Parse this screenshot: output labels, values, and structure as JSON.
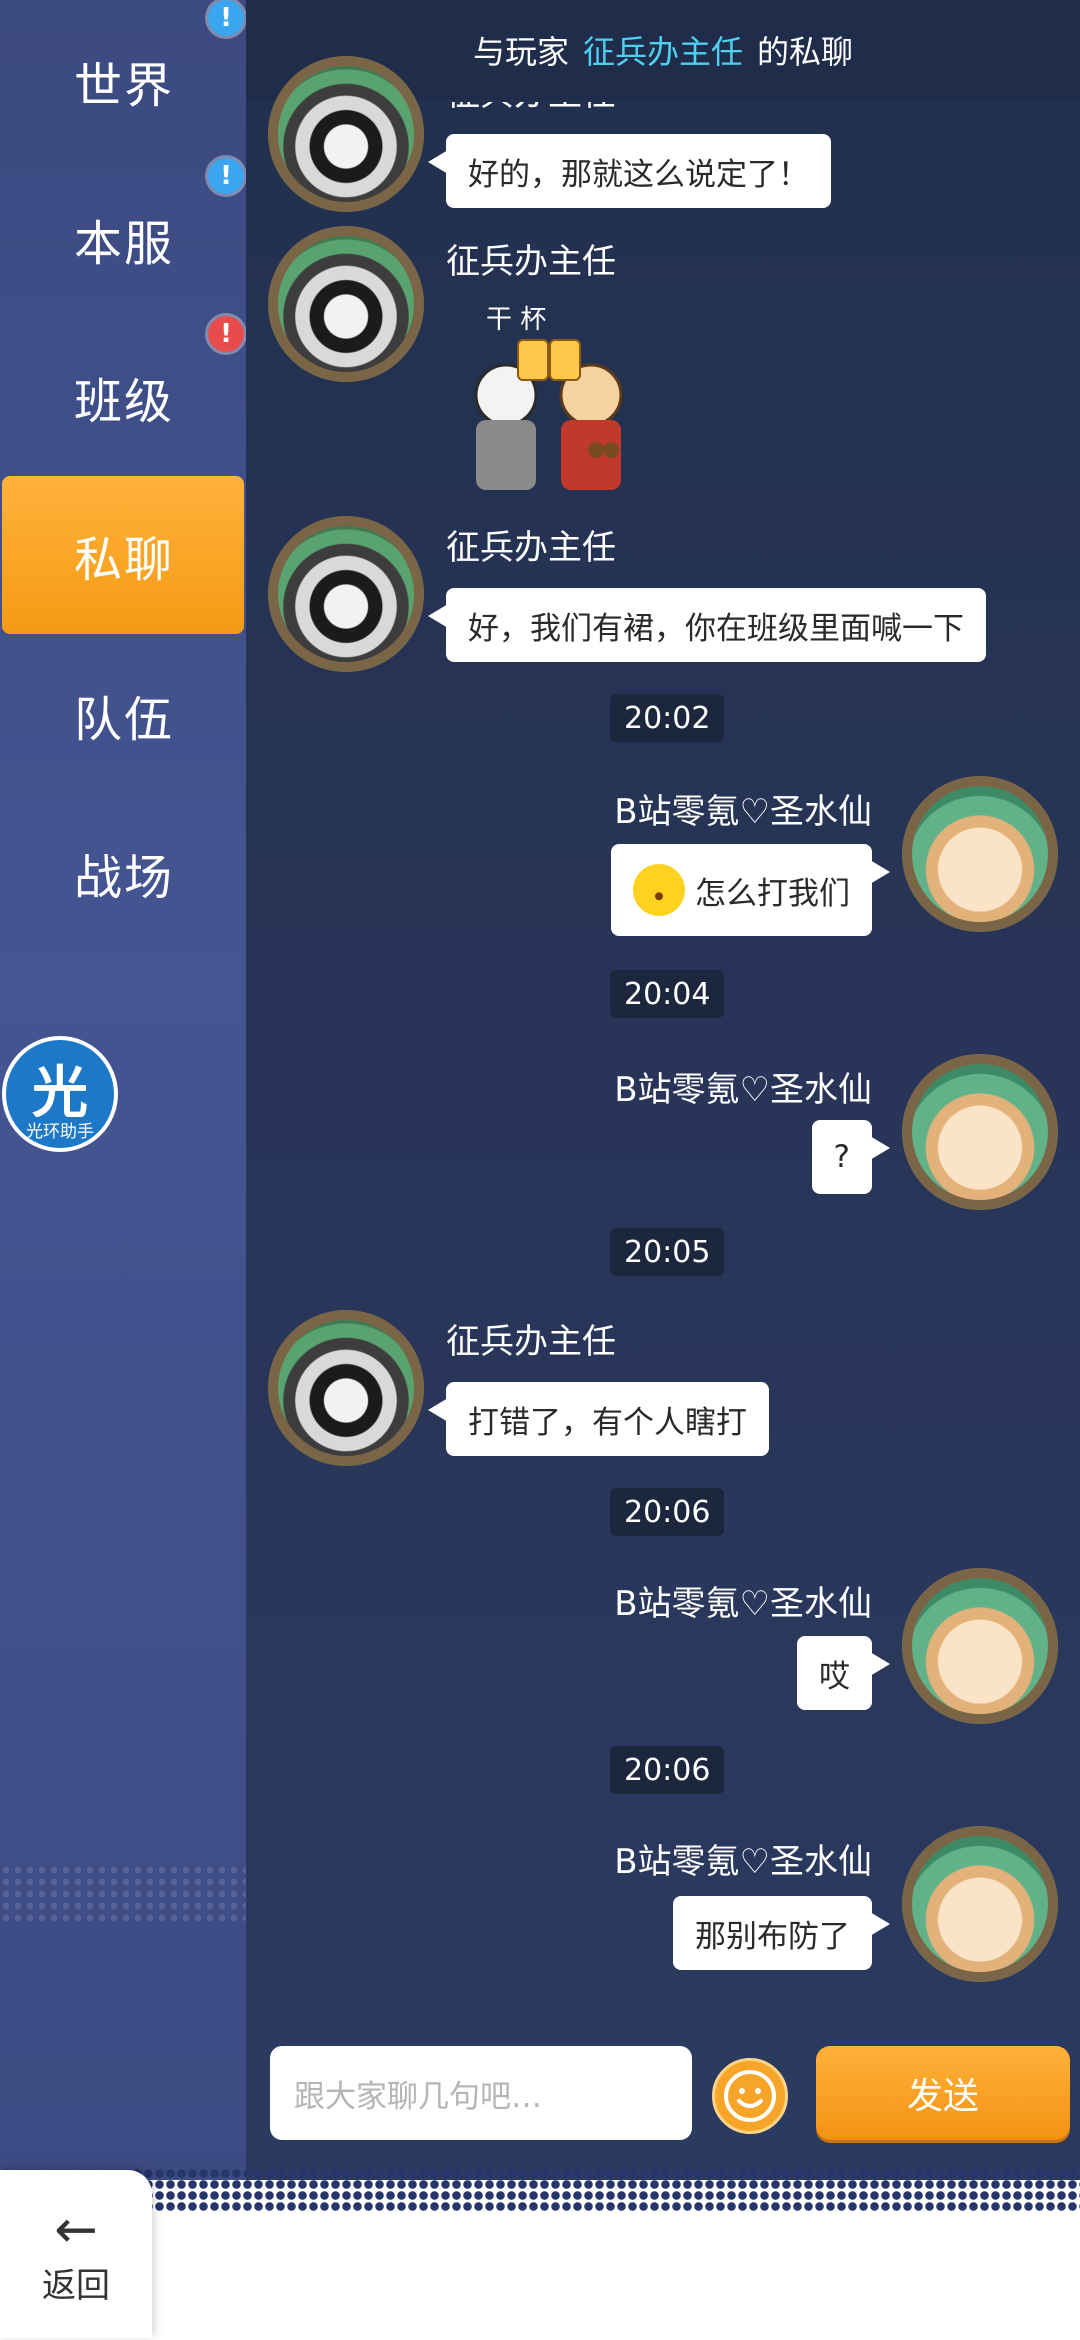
{
  "sidebar": {
    "items": [
      {
        "label": "世界",
        "badge": "!",
        "badge_color": "#3aa6f0"
      },
      {
        "label": "本服",
        "badge": "!",
        "badge_color": "#3aa6f0"
      },
      {
        "label": "班级",
        "badge": "!",
        "badge_color": "#e84b4b"
      },
      {
        "label": "私聊",
        "active": true
      },
      {
        "label": "队伍"
      },
      {
        "label": "战场"
      }
    ],
    "logo": {
      "big": "光",
      "small": "光环助手"
    },
    "active_color": "#f59a15"
  },
  "header": {
    "prefix": "与玩家",
    "player": "征兵办主任",
    "suffix": "的私聊",
    "highlight_color": "#4fd0f0"
  },
  "messages": [
    {
      "sender": "征兵办主任",
      "text": "好的，那就这么说定了！"
    },
    {
      "sender": "征兵办主任",
      "sticker": "干 杯"
    },
    {
      "sender": "征兵办主任",
      "text": "好，我们有裙，你在班级里面喊一下"
    },
    {
      "time": "20:02"
    },
    {
      "sender": "B站零氪♡圣水仙",
      "text": "怎么打我们",
      "emoji": "surprised-face"
    },
    {
      "time": "20:04"
    },
    {
      "sender": "B站零氪♡圣水仙",
      "text": "?"
    },
    {
      "time": "20:05"
    },
    {
      "sender": "征兵办主任",
      "text": "打错了，有个人瞎打"
    },
    {
      "time": "20:06"
    },
    {
      "sender": "B站零氪♡圣水仙",
      "text": "哎"
    },
    {
      "time": "20:06"
    },
    {
      "sender": "B站零氪♡圣水仙",
      "text": "那别布防了"
    }
  ],
  "input": {
    "placeholder": "跟大家聊几句吧…"
  },
  "send_label": "发送",
  "back_label": "返回"
}
